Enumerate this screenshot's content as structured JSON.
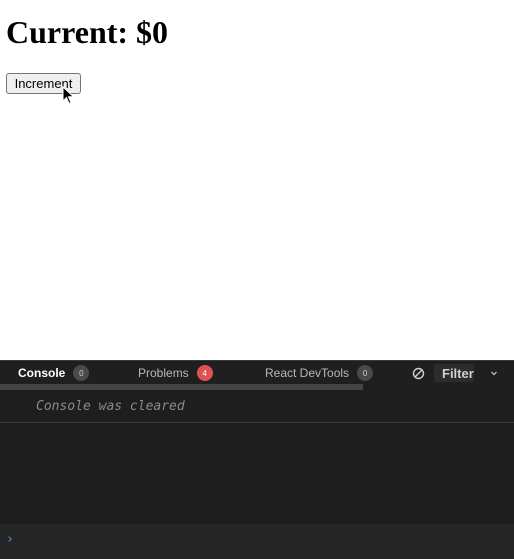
{
  "preview": {
    "heading": "Current: $0",
    "increment_label": "Increment"
  },
  "devtools": {
    "tabs": [
      {
        "label": "Console",
        "count": "0",
        "active": true
      },
      {
        "label": "Problems",
        "count": "4",
        "badge_color": "#e05252"
      },
      {
        "label": "React DevTools",
        "count": "0"
      }
    ],
    "filter_label": "Filter",
    "console_message": "Console was cleared",
    "prompt_symbol": "›",
    "icons": {
      "clear": "clear-console-icon",
      "chevron": "chevron-down-icon",
      "cursor": "mouse-cursor-icon"
    }
  }
}
